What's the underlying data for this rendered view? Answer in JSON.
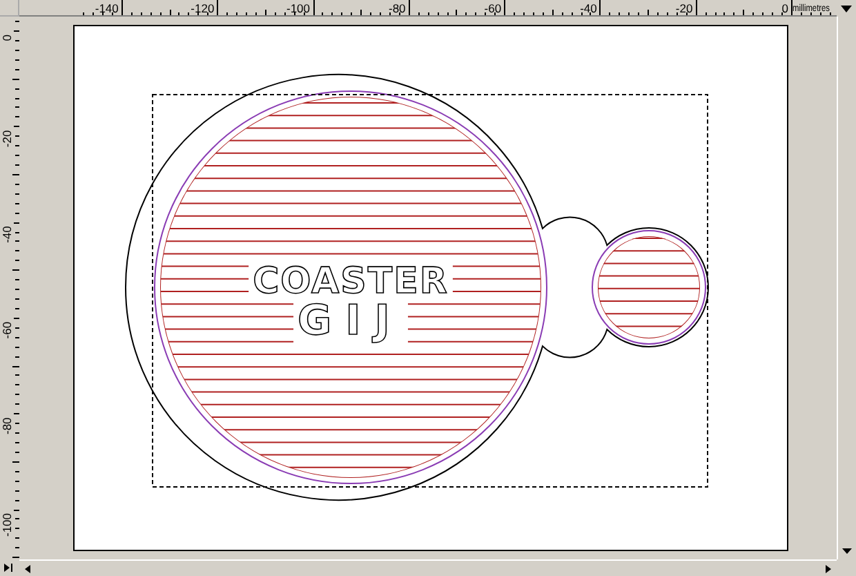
{
  "rulers": {
    "unit": "millimetres",
    "top_labels": [
      "-140",
      "-120",
      "-100",
      "-80",
      "-60",
      "-40",
      "-20",
      "0"
    ],
    "left_labels": [
      "0",
      "-20",
      "-40",
      "-60",
      "-80",
      "-100"
    ]
  },
  "artwork": {
    "text_lines": [
      "COASTER",
      "GIJ"
    ]
  }
}
